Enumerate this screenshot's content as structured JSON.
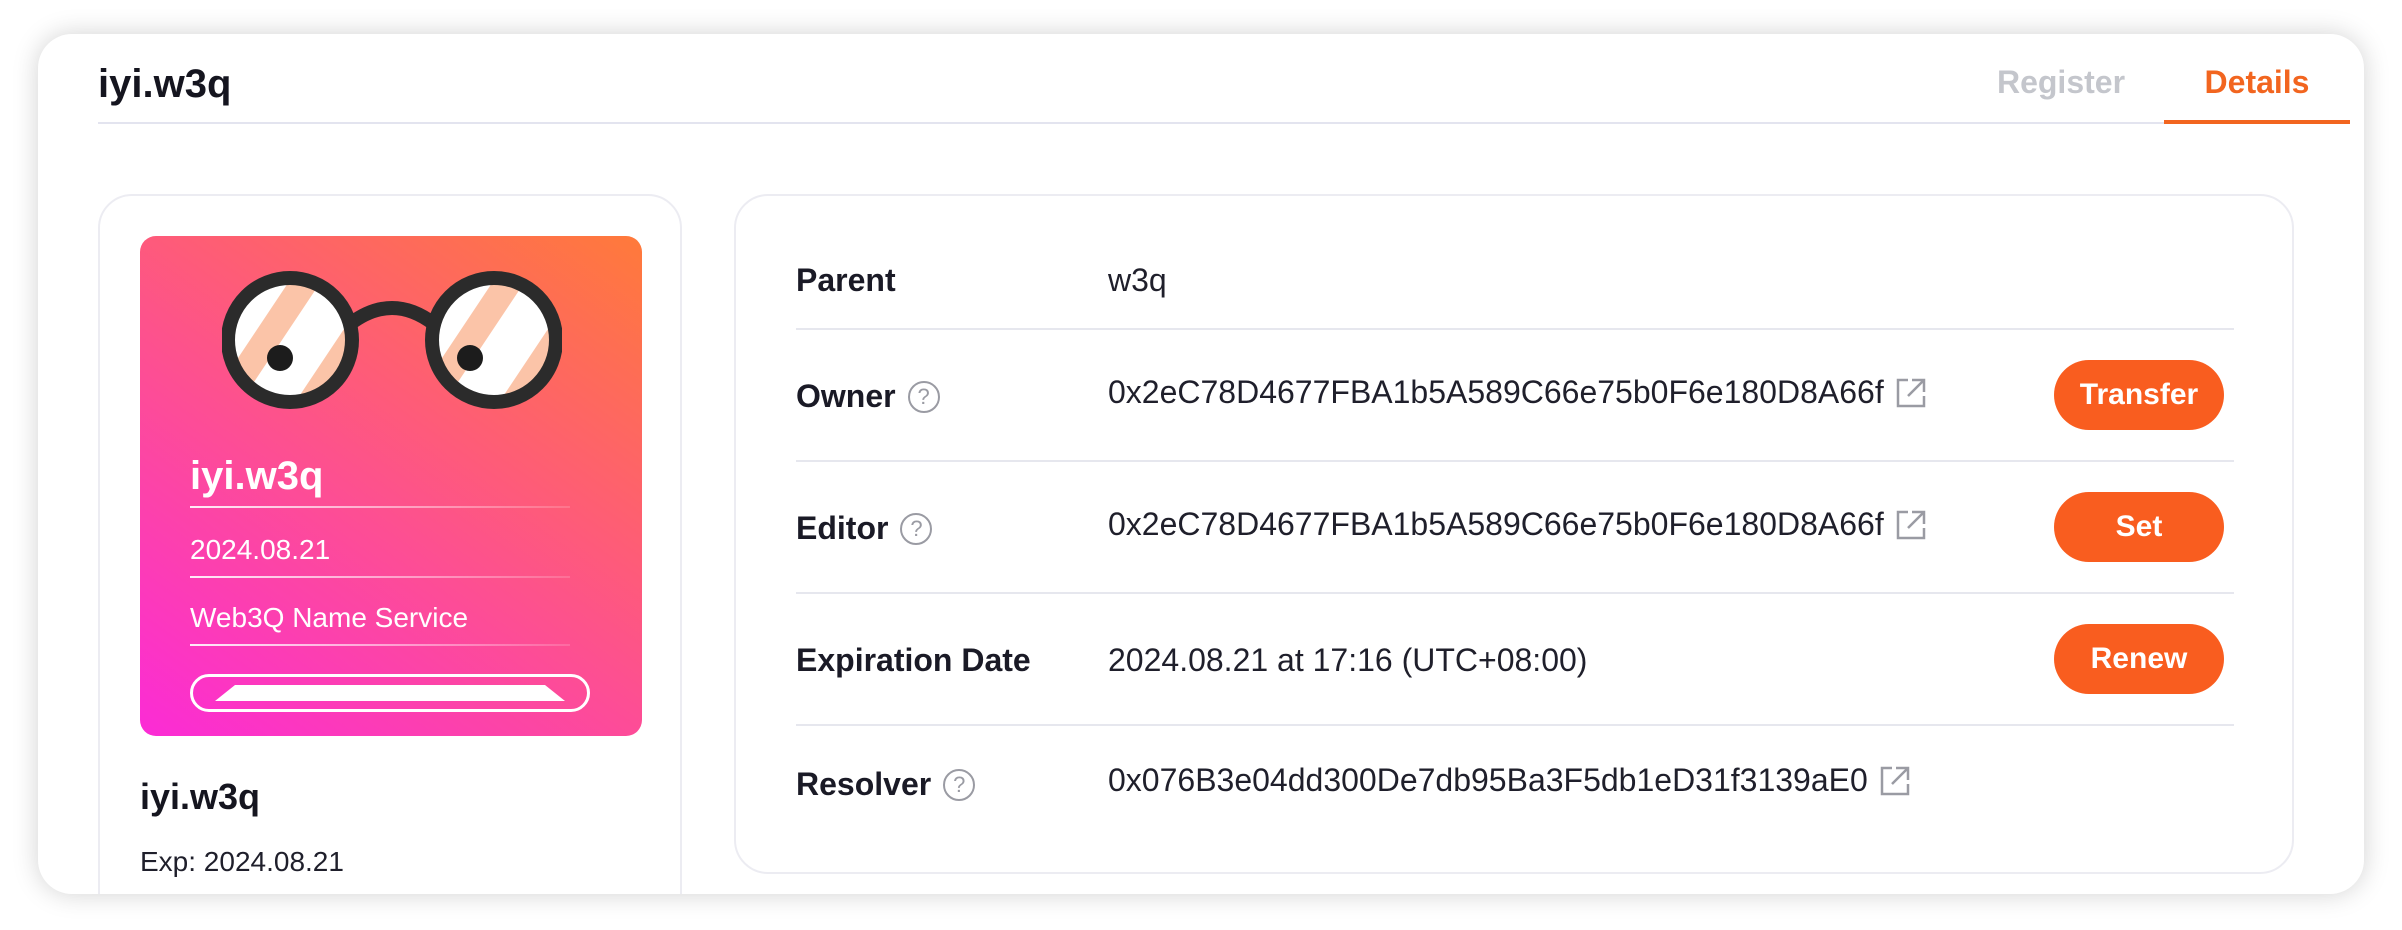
{
  "header": {
    "title": "iyi.w3q",
    "tabs": [
      {
        "label": "Register",
        "active": false
      },
      {
        "label": "Details",
        "active": true
      }
    ],
    "accent_color": "#f2651f"
  },
  "nft_card": {
    "name": "iyi.w3q",
    "date": "2024.08.21",
    "service": "Web3Q Name Service",
    "gradient": [
      "#fb2bd6",
      "#ff7a3a"
    ]
  },
  "card_info": {
    "name": "iyi.w3q",
    "exp": "Exp: 2024.08.21"
  },
  "details": {
    "parent": {
      "label": "Parent",
      "value": "w3q"
    },
    "owner": {
      "label": "Owner",
      "value": "0x2eC78D4677FBA1b5A589C66e75b0F6e180D8A66f",
      "button": "Transfer"
    },
    "editor": {
      "label": "Editor",
      "value": "0x2eC78D4677FBA1b5A589C66e75b0F6e180D8A66f",
      "button": "Set"
    },
    "expiration": {
      "label": "Expiration Date",
      "value": "2024.08.21 at 17:16 (UTC+08:00)",
      "button": "Renew"
    },
    "resolver": {
      "label": "Resolver",
      "value": "0x076B3e04dd300De7db95Ba3F5db1eD31f3139aE0"
    }
  },
  "help_symbol": "?",
  "icons": [
    "help-circle-icon",
    "external-link-icon",
    "glasses-logo-icon"
  ],
  "button_color": "#f95d1f"
}
